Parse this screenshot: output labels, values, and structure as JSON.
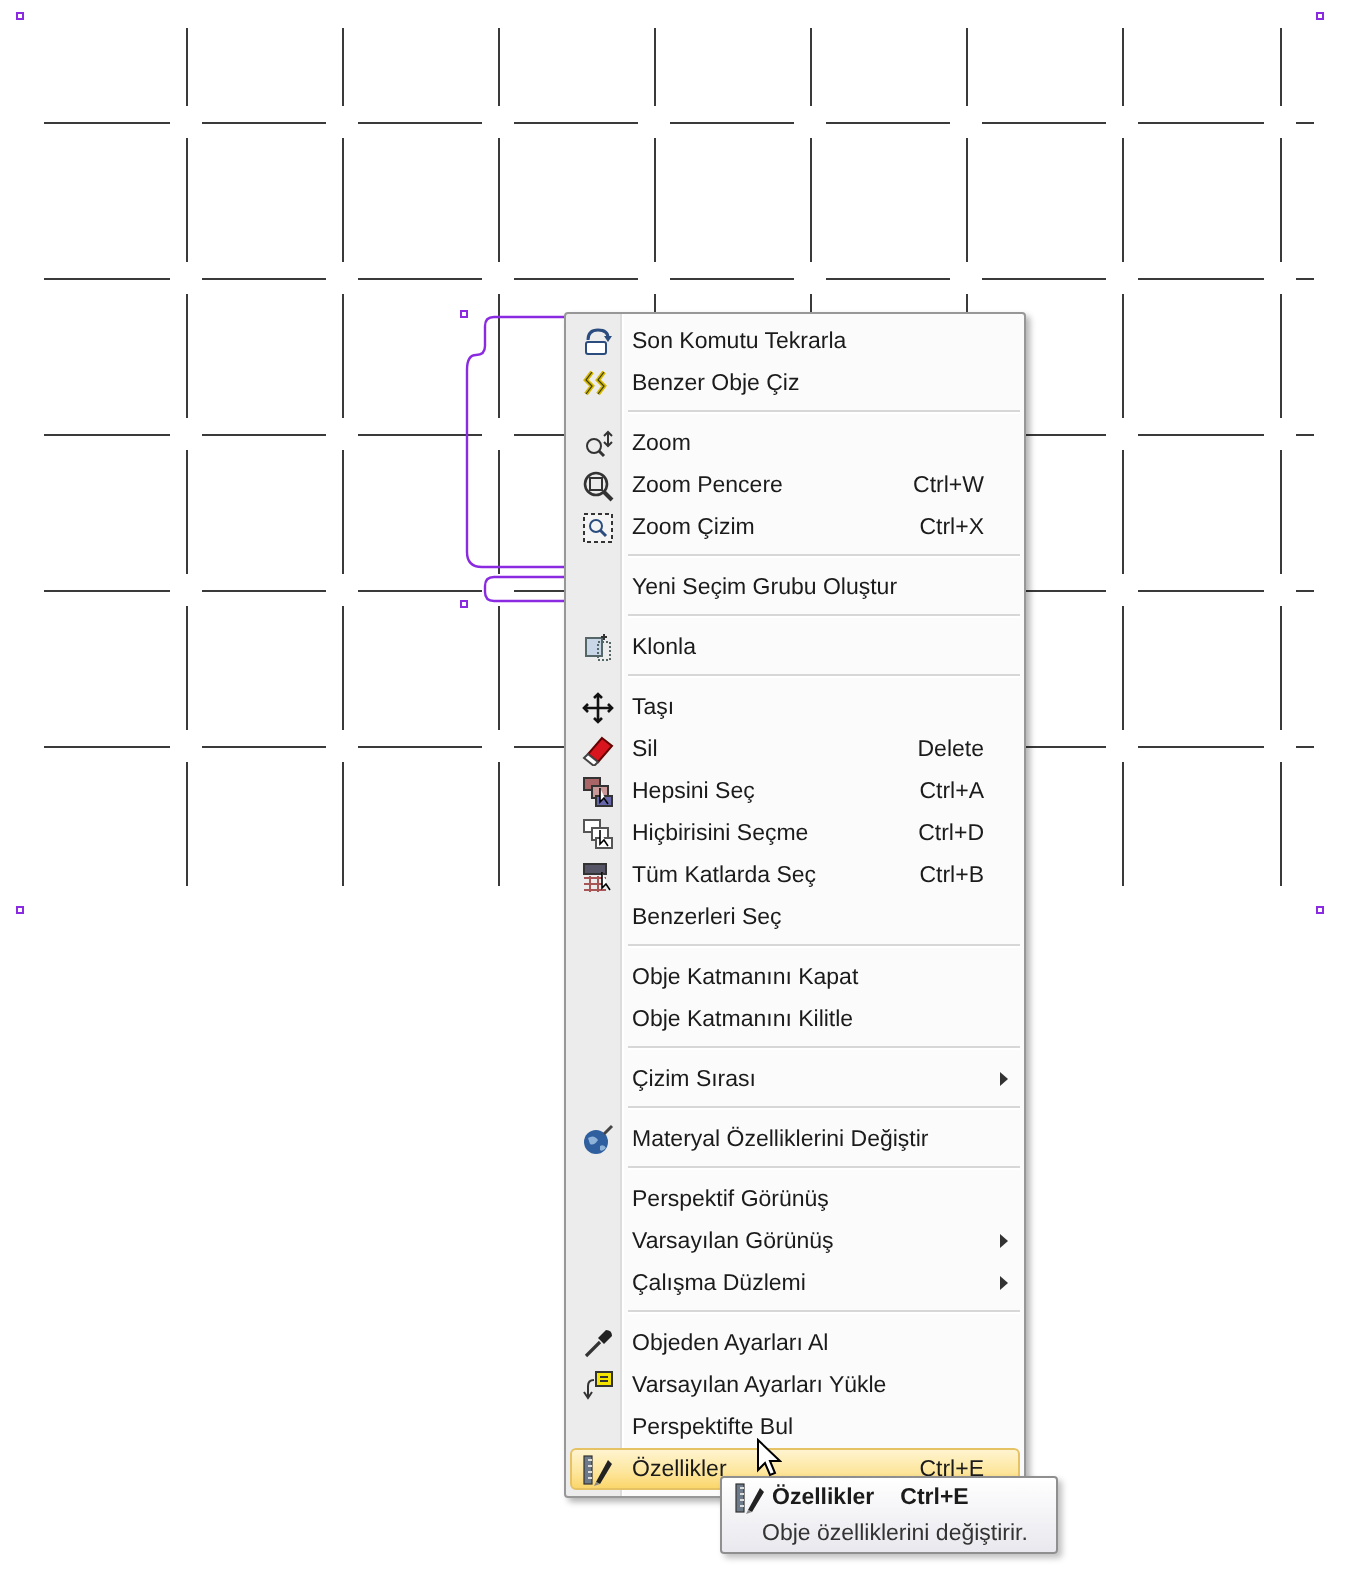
{
  "context_menu": {
    "items": [
      {
        "kind": "item",
        "label": "Son Komutu Tekrarla",
        "selected": false
      },
      {
        "kind": "item",
        "label": "Benzer Obje Çiz",
        "selected": false
      },
      {
        "kind": "separator"
      },
      {
        "kind": "item",
        "label": "Zoom",
        "selected": false
      },
      {
        "kind": "item",
        "label": "Zoom Pencere",
        "shortcut": "Ctrl+W",
        "selected": false
      },
      {
        "kind": "item",
        "label": "Zoom Çizim",
        "shortcut": "Ctrl+X",
        "selected": false
      },
      {
        "kind": "separator"
      },
      {
        "kind": "item",
        "label": "Yeni Seçim Grubu Oluştur",
        "selected": false
      },
      {
        "kind": "separator"
      },
      {
        "kind": "item",
        "label": "Klonla",
        "selected": false
      },
      {
        "kind": "separator"
      },
      {
        "kind": "item",
        "label": "Taşı",
        "selected": false
      },
      {
        "kind": "item",
        "label": "Sil",
        "shortcut": "Delete",
        "selected": false
      },
      {
        "kind": "item",
        "label": "Hepsini Seç",
        "shortcut": "Ctrl+A",
        "selected": false
      },
      {
        "kind": "item",
        "label": "Hiçbirisini Seçme",
        "shortcut": "Ctrl+D",
        "selected": false
      },
      {
        "kind": "item",
        "label": "Tüm Katlarda Seç",
        "shortcut": "Ctrl+B",
        "selected": false
      },
      {
        "kind": "item",
        "label": "Benzerleri Seç",
        "selected": false
      },
      {
        "kind": "separator"
      },
      {
        "kind": "item",
        "label": "Obje Katmanını Kapat",
        "selected": false
      },
      {
        "kind": "item",
        "label": "Obje Katmanını Kilitle",
        "selected": false
      },
      {
        "kind": "separator"
      },
      {
        "kind": "item",
        "label": "Çizim Sırası",
        "submenu": true,
        "selected": false
      },
      {
        "kind": "separator"
      },
      {
        "kind": "item",
        "label": "Materyal Özelliklerini Değiştir",
        "selected": false
      },
      {
        "kind": "separator"
      },
      {
        "kind": "item",
        "label": "Perspektif Görünüş",
        "selected": false
      },
      {
        "kind": "item",
        "label": "Varsayılan Görünüş",
        "submenu": true,
        "selected": false
      },
      {
        "kind": "item",
        "label": "Çalışma Düzlemi",
        "submenu": true,
        "selected": false
      },
      {
        "kind": "separator"
      },
      {
        "kind": "item",
        "label": "Objeden Ayarları Al",
        "selected": false
      },
      {
        "kind": "item",
        "label": "Varsayılan Ayarları Yükle",
        "selected": false
      },
      {
        "kind": "item",
        "label": "Perspektifte Bul",
        "selected": false
      },
      {
        "kind": "item",
        "label": "Özellikler",
        "shortcut": "Ctrl+E",
        "selected": true
      }
    ]
  },
  "tooltip": {
    "title": "Özellikler",
    "shortcut": "Ctrl+E",
    "description": "Obje özelliklerini değiştirir."
  }
}
